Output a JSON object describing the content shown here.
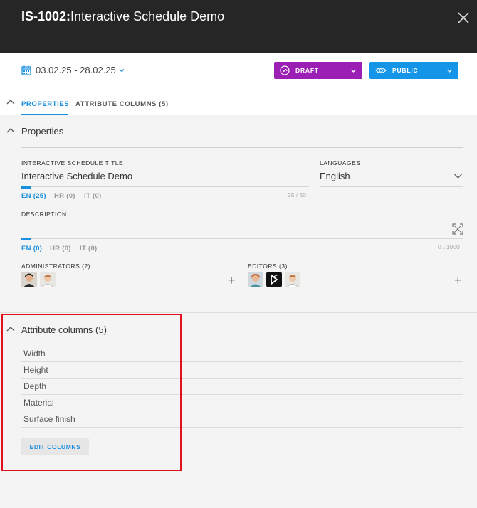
{
  "header": {
    "code": "IS-1002:",
    "name": "Interactive Schedule Demo",
    "close_icon": "close-icon"
  },
  "toolbar": {
    "date_range": "03.02.25 - 28.02.25",
    "status_label": "DRAFT",
    "status_color": "#9b1fb4",
    "visibility_label": "PUBLIC",
    "visibility_color": "#1495e8"
  },
  "tabs": [
    {
      "label": "PROPERTIES",
      "active": true
    },
    {
      "label": "ATTRIBUTE COLUMNS (5)",
      "active": false
    }
  ],
  "accent_color": "#1a8fe0",
  "properties": {
    "section_title": "Properties",
    "title_field": {
      "label": "INTERACTIVE SCHEDULE TITLE",
      "value": "Interactive Schedule Demo",
      "lang_tabs": [
        "EN (25)",
        "HR (0)",
        "IT (0)"
      ],
      "counter": "25 / 50"
    },
    "languages": {
      "label": "LANGUAGES",
      "value": "English"
    },
    "description": {
      "label": "DESCRIPTION",
      "value": "",
      "lang_tabs": [
        "EN (0)",
        "HR (0)",
        "IT (0)"
      ],
      "counter": "0 / 1000"
    },
    "administrators": {
      "label": "ADMINISTRATORS (2)"
    },
    "editors": {
      "label": "EDITORS (3)"
    }
  },
  "attribute_columns": {
    "section_title": "Attribute columns (5)",
    "columns": [
      "Width",
      "Height",
      "Depth",
      "Material",
      "Surface finish"
    ],
    "edit_button": "EDIT COLUMNS"
  }
}
